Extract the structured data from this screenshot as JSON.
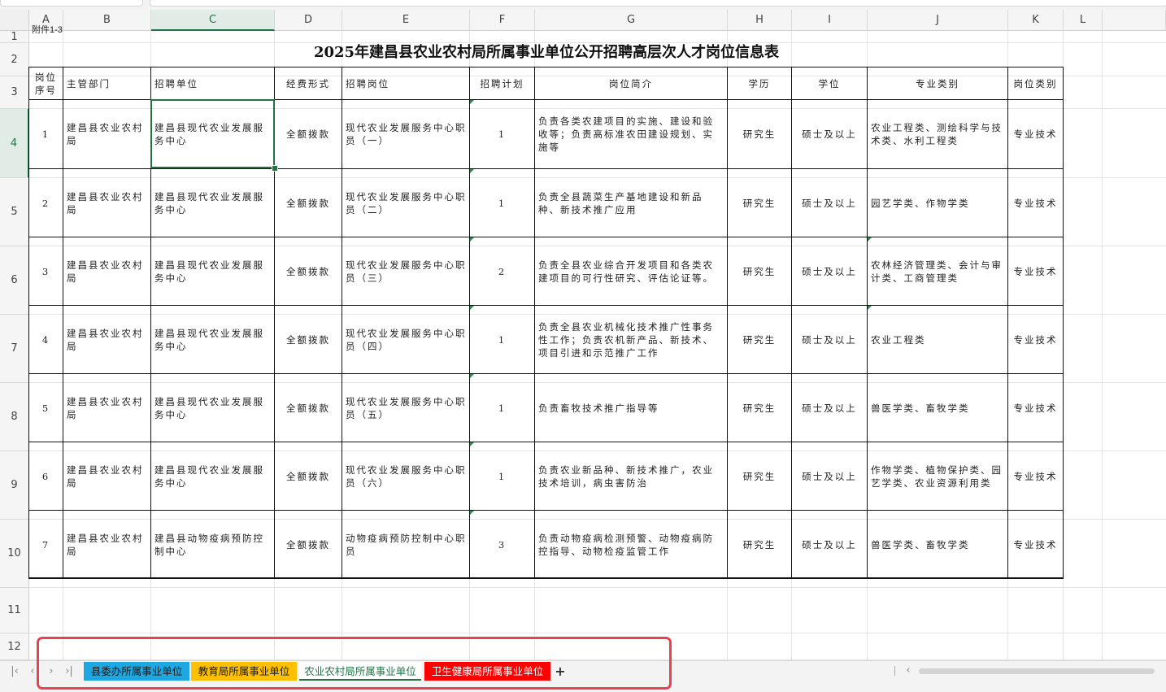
{
  "sheet": {
    "columns": [
      "A",
      "B",
      "C",
      "D",
      "E",
      "F",
      "G",
      "H",
      "I",
      "J",
      "K",
      "L"
    ],
    "active_column": "C",
    "rows": [
      "1",
      "2",
      "3",
      "4",
      "5",
      "6",
      "7",
      "8",
      "9",
      "10",
      "11",
      "12"
    ],
    "active_row": "4"
  },
  "attachment_label": "附件1-3",
  "title": "2025年建昌县农业农村局所属事业单位公开招聘高层次人才岗位信息表",
  "table": {
    "headers": [
      "岗位序号",
      "主管部门",
      "招聘单位",
      "经费形式",
      "招聘岗位",
      "招聘计划",
      "岗位简介",
      "学历",
      "学位",
      "专业类别",
      "岗位类别"
    ],
    "rows": [
      [
        "1",
        "建昌县农业农村局",
        "建昌县现代农业发展服务中心",
        "全额拨款",
        "现代农业发展服务中心职员（一）",
        "1",
        "负责各类农建项目的实施、建设和验收等；负责高标准农田建设规划、实施等",
        "研究生",
        "硕士及以上",
        "农业工程类、测绘科学与技术类、水利工程类",
        "专业技术"
      ],
      [
        "2",
        "建昌县农业农村局",
        "建昌县现代农业发展服务中心",
        "全额拨款",
        "现代农业发展服务中心职员（二）",
        "1",
        "负责全县蔬菜生产基地建设和新品种、新技术推广应用",
        "研究生",
        "硕士及以上",
        "园艺学类、作物学类",
        "专业技术"
      ],
      [
        "3",
        "建昌县农业农村局",
        "建昌县现代农业发展服务中心",
        "全额拨款",
        "现代农业发展服务中心职员（三）",
        "2",
        "负责全县农业综合开发项目和各类农建项目的可行性研究、评估论证等。",
        "研究生",
        "硕士及以上",
        "农林经济管理类、会计与审计类、工商管理类",
        "专业技术"
      ],
      [
        "4",
        "建昌县农业农村局",
        "建昌县现代农业发展服务中心",
        "全额拨款",
        "现代农业发展服务中心职员（四）",
        "1",
        "负责全县农业机械化技术推广性事务性工作；负责农机新产品、新技术、项目引进和示范推广工作",
        "研究生",
        "硕士及以上",
        "农业工程类",
        "专业技术"
      ],
      [
        "5",
        "建昌县农业农村局",
        "建昌县现代农业发展服务中心",
        "全额拨款",
        "现代农业发展服务中心职员（五）",
        "1",
        "负责畜牧技术推广指导等",
        "研究生",
        "硕士及以上",
        "兽医学类、畜牧学类",
        "专业技术"
      ],
      [
        "6",
        "建昌县农业农村局",
        "建昌县现代农业发展服务中心",
        "全额拨款",
        "现代农业发展服务中心职员（六）",
        "1",
        "负责农业新品种、新技术推广，农业技术培训，病虫害防治",
        "研究生",
        "硕士及以上",
        "作物学类、植物保护类、园艺学类、农业资源利用类",
        "专业技术"
      ],
      [
        "7",
        "建昌县农业农村局",
        "建昌县动物疫病预防控制中心",
        "全额拨款",
        "动物疫病预防控制中心职员",
        "3",
        "负责动物疫病检测预警、动物疫病防控指导、动物检疫监管工作",
        "研究生",
        "硕士及以上",
        "兽医学类、畜牧学类",
        "专业技术"
      ]
    ]
  },
  "tabs": [
    {
      "label": "县委办所属事业单位",
      "color": "#1ea7e1",
      "text_color": "#1a1a1a",
      "active": false
    },
    {
      "label": "教育局所属事业单位",
      "color": "#ffc000",
      "text_color": "#1a1a1a",
      "active": false
    },
    {
      "label": "农业农村局所属事业单位",
      "color": "#ffffff",
      "text_color": "#217346",
      "active": true
    },
    {
      "label": "卫生健康局所属事业单位",
      "color": "#ff0000",
      "text_color": "#ffffff",
      "active": false
    }
  ],
  "icons": {
    "first_sheet": "first-sheet-icon",
    "prev_sheet": "prev-sheet-icon",
    "next_sheet": "next-sheet-icon",
    "last_sheet": "last-sheet-icon",
    "add_sheet": "add-sheet-icon"
  },
  "nav_glyphs": {
    "first": "|‹",
    "prev": "‹",
    "next": "›",
    "last": "›|",
    "add": "+"
  }
}
